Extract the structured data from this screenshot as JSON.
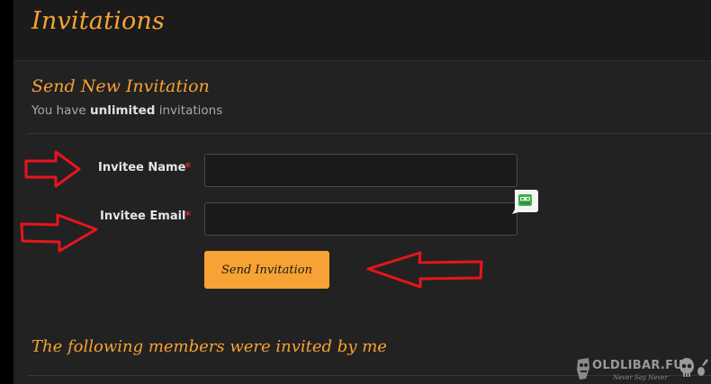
{
  "header": {
    "title": "Invitations"
  },
  "send_section": {
    "title": "Send New Invitation",
    "subtitle_prefix": "You have ",
    "subtitle_bold": "unlimited",
    "subtitle_suffix": " invitations"
  },
  "form": {
    "name_label": "Invitee Name",
    "name_value": "",
    "email_label": "Invitee Email",
    "email_value": "",
    "required_mark": "*",
    "submit_label": "Send Invitation"
  },
  "members_section": {
    "title": "The following members were invited by me"
  },
  "watermark": {
    "name": "OLDLIBAR.FUN",
    "tagline": "Never Say Never"
  },
  "colors": {
    "accent": "#f7a234",
    "panel": "#222222",
    "header": "#1b1b1b",
    "required": "#e0322b",
    "annotation_arrow": "#e8141c",
    "helper_icon": "#3fae48"
  },
  "icons": {
    "floating_helper": "chat-bot-icon",
    "annotation": "red-arrow-icon"
  }
}
